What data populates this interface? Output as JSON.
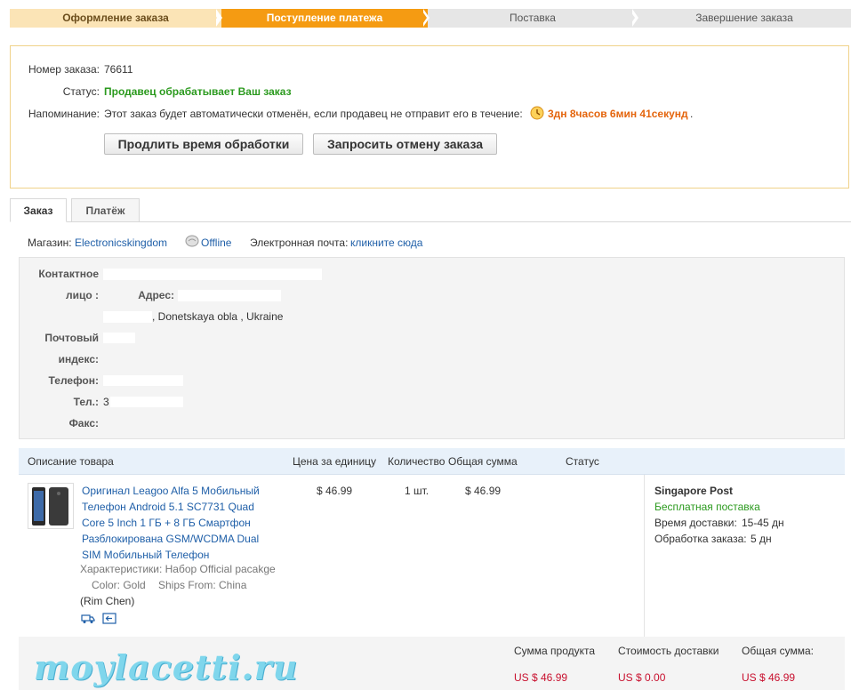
{
  "steps": [
    "Оформление заказа",
    "Поступление платежа",
    "Поставка",
    "Завершение заказа"
  ],
  "order": {
    "number_label": "Номер заказа:",
    "number_value": "76611",
    "status_label": "Статус:",
    "status_value": "Продавец обрабатывает Ваш заказ",
    "reminder_label": "Напоминание:",
    "reminder_text": "Этот заказ будет автоматически отменён, если продавец не отправит его в течение:",
    "countdown": "3дн 8часов 6мин 41секунд",
    "countdown_suffix": ".",
    "btn_extend": "Продлить время обработки",
    "btn_cancel": "Запросить отмену заказа"
  },
  "tabs": [
    "Заказ",
    "Платёж"
  ],
  "store": {
    "label": "Магазин:",
    "name": "Electronicskingdom",
    "status": "Offline",
    "email_label": "Электронная почта:",
    "email_link": "кликните сюда"
  },
  "address": {
    "contact_label_1": "Контактное",
    "contact_label_2": "лицо :",
    "addr_label": "Адрес:",
    "addr_line2": ", Donetskaya obla  , Ukraine",
    "postal_label_1": "Почтовый",
    "postal_label_2": "индекс:",
    "phone_label": "Телефон:",
    "tel_label": "Тел.:",
    "tel_value": "3",
    "fax_label": "Факс:"
  },
  "items_header": {
    "desc": "Описание товара",
    "price": "Цена за единицу",
    "qty": "Количество",
    "total": "Общая сумма",
    "status": "Статус"
  },
  "item": {
    "title": "Оригинал Leagoo Alfa 5 Мобильный Телефон Android 5.1 SC7731 Quad Core 5 Inch 1 ГБ + 8 ГБ Смартфон Разблокирована GSM/WCDMA Dual SIM Мобильный Телефон",
    "title_lines": [
      "Оригинал Leagoo Alfa 5 Мобильный",
      "Телефон Android 5.1 SC7731 Quad",
      "Core 5 Inch 1 ГБ + 8 ГБ Смартфон",
      "Разблокирована GSM/WCDMA Dual",
      "SIM Мобильный Телефон"
    ],
    "specs": "Характеристики: Набор Official pacakge",
    "color": "Color: Gold",
    "ships": "Ships From: China",
    "seller": "(Rim Chen)",
    "price": "$ 46.99",
    "qty": "1 шт.",
    "total": "$ 46.99"
  },
  "shipping": {
    "carrier": "Singapore Post",
    "free": "Бесплатная поставка",
    "time_label": "Время доставки:",
    "time_value": "15-45 дн",
    "proc_label": "Обработка заказа:",
    "proc_value": "5 дн"
  },
  "totals": {
    "product_label": "Сумма продукта",
    "product_value": "US $ 46.99",
    "ship_label": "Стоимость доставки",
    "ship_value": "US $ 0.00",
    "total_label": "Общая сумма:",
    "total_value": "US $ 46.99"
  },
  "watermark": "moylacetti.ru",
  "colors": {
    "accent": "#f59b12",
    "link": "#1f5fa8",
    "green": "#2b9a1e",
    "red": "#c8102e",
    "countdown": "#e4650d"
  }
}
